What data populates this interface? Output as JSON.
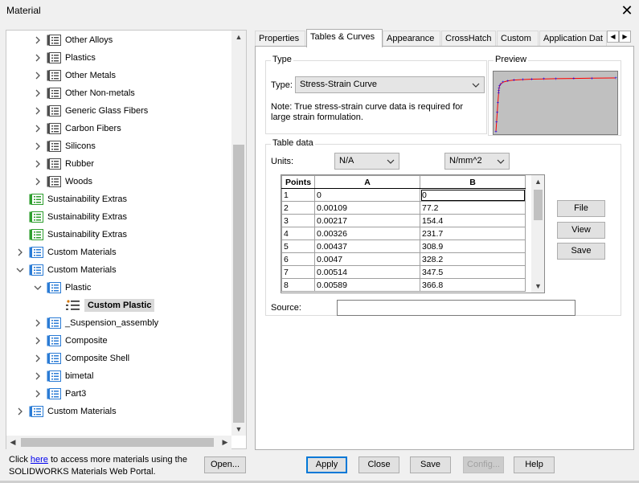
{
  "window": {
    "title": "Material"
  },
  "tree": {
    "items": [
      {
        "label": "Other Alloys",
        "level": 2,
        "expanded": false,
        "icon": "material-db-icon",
        "icon_color": "gray"
      },
      {
        "label": "Plastics",
        "level": 2,
        "expanded": false,
        "icon": "material-db-icon",
        "icon_color": "gray"
      },
      {
        "label": "Other Metals",
        "level": 2,
        "expanded": false,
        "icon": "material-db-icon",
        "icon_color": "gray"
      },
      {
        "label": "Other Non-metals",
        "level": 2,
        "expanded": false,
        "icon": "material-db-icon",
        "icon_color": "gray"
      },
      {
        "label": "Generic Glass Fibers",
        "level": 2,
        "expanded": false,
        "icon": "material-db-icon",
        "icon_color": "gray"
      },
      {
        "label": "Carbon Fibers",
        "level": 2,
        "expanded": false,
        "icon": "material-db-icon",
        "icon_color": "gray"
      },
      {
        "label": "Silicons",
        "level": 2,
        "expanded": false,
        "icon": "material-db-icon",
        "icon_color": "gray"
      },
      {
        "label": "Rubber",
        "level": 2,
        "expanded": false,
        "icon": "material-db-icon",
        "icon_color": "gray"
      },
      {
        "label": "Woods",
        "level": 2,
        "expanded": false,
        "icon": "material-db-icon",
        "icon_color": "gray"
      },
      {
        "label": "Sustainability Extras",
        "level": 1,
        "expanded": null,
        "icon": "library-icon",
        "icon_color": "green"
      },
      {
        "label": "Sustainability Extras",
        "level": 1,
        "expanded": null,
        "icon": "library-icon",
        "icon_color": "green"
      },
      {
        "label": "Sustainability Extras",
        "level": 1,
        "expanded": null,
        "icon": "library-icon",
        "icon_color": "green"
      },
      {
        "label": "Custom Materials",
        "level": 1,
        "expanded": false,
        "icon": "library-icon",
        "icon_color": "blue"
      },
      {
        "label": "Custom Materials",
        "level": 1,
        "expanded": true,
        "icon": "library-icon",
        "icon_color": "blue"
      },
      {
        "label": "Plastic",
        "level": 2,
        "expanded": true,
        "icon": "material-db-icon",
        "icon_color": "blue"
      },
      {
        "label": "Custom Plastic",
        "level": 3,
        "expanded": null,
        "icon": "material-icon",
        "icon_color": "black",
        "selected": true
      },
      {
        "label": "_Suspension_assembly",
        "level": 2,
        "expanded": false,
        "icon": "material-db-icon",
        "icon_color": "blue"
      },
      {
        "label": "Composite",
        "level": 2,
        "expanded": false,
        "icon": "material-db-icon",
        "icon_color": "blue"
      },
      {
        "label": "Composite Shell",
        "level": 2,
        "expanded": false,
        "icon": "material-db-icon",
        "icon_color": "blue"
      },
      {
        "label": "bimetal",
        "level": 2,
        "expanded": false,
        "icon": "material-db-icon",
        "icon_color": "blue"
      },
      {
        "label": "Part3",
        "level": 2,
        "expanded": false,
        "icon": "material-db-icon",
        "icon_color": "blue"
      },
      {
        "label": "Custom Materials",
        "level": 1,
        "expanded": false,
        "icon": "library-icon",
        "icon_color": "blue"
      }
    ]
  },
  "tabs": [
    {
      "label": "Properties",
      "active": false
    },
    {
      "label": "Tables & Curves",
      "active": true
    },
    {
      "label": "Appearance",
      "active": false
    },
    {
      "label": "CrossHatch",
      "active": false
    },
    {
      "label": "Custom",
      "active": false
    },
    {
      "label": "Application Dat",
      "active": false
    }
  ],
  "type_group": {
    "label": "Type",
    "type_label": "Type:",
    "type_value": "Stress-Strain Curve",
    "note": "Note: True stress-strain curve data is required for large strain formulation."
  },
  "preview": {
    "label": "Preview",
    "curve_color": "#ff0000",
    "point_color": "#0000ff",
    "points": [
      [
        0,
        0
      ],
      [
        0.00109,
        77.2
      ],
      [
        0.00217,
        154.4
      ],
      [
        0.00326,
        231.7
      ],
      [
        0.00437,
        308.9
      ],
      [
        0.0047,
        328.2
      ],
      [
        0.00514,
        347.5
      ],
      [
        0.00589,
        366.8
      ],
      [
        0.008,
        385
      ],
      [
        0.012,
        400
      ],
      [
        0.02,
        410
      ],
      [
        0.03,
        416
      ],
      [
        0.045,
        420
      ],
      [
        0.06,
        423
      ],
      [
        0.08,
        425
      ],
      [
        0.1,
        427
      ],
      [
        0.13,
        429
      ],
      [
        0.16,
        431
      ],
      [
        0.2,
        433
      ]
    ]
  },
  "table_group": {
    "label": "Table data",
    "units_label": "Units:",
    "unit_a": "N/A",
    "unit_b": "N/mm^2",
    "columns": [
      "Points",
      "A",
      "B"
    ],
    "rows": [
      [
        "1",
        "0",
        "0"
      ],
      [
        "2",
        "0.00109",
        "77.2"
      ],
      [
        "3",
        "0.00217",
        "154.4"
      ],
      [
        "4",
        "0.00326",
        "231.7"
      ],
      [
        "5",
        "0.00437",
        "308.9"
      ],
      [
        "6",
        "0.0047",
        "328.2"
      ],
      [
        "7",
        "0.00514",
        "347.5"
      ],
      [
        "8",
        "0.00589",
        "366.8"
      ]
    ],
    "file_button": "File",
    "view_button": "View",
    "save_button": "Save",
    "source_label": "Source:",
    "source_value": ""
  },
  "footer": {
    "text_before": "Click ",
    "link": "here",
    "text_after": " to access more materials using the SOLIDWORKS Materials Web Portal.",
    "open_button": "Open...",
    "apply_button": "Apply",
    "close_button": "Close",
    "save_button": "Save",
    "config_button": "Config...",
    "help_button": "Help"
  }
}
